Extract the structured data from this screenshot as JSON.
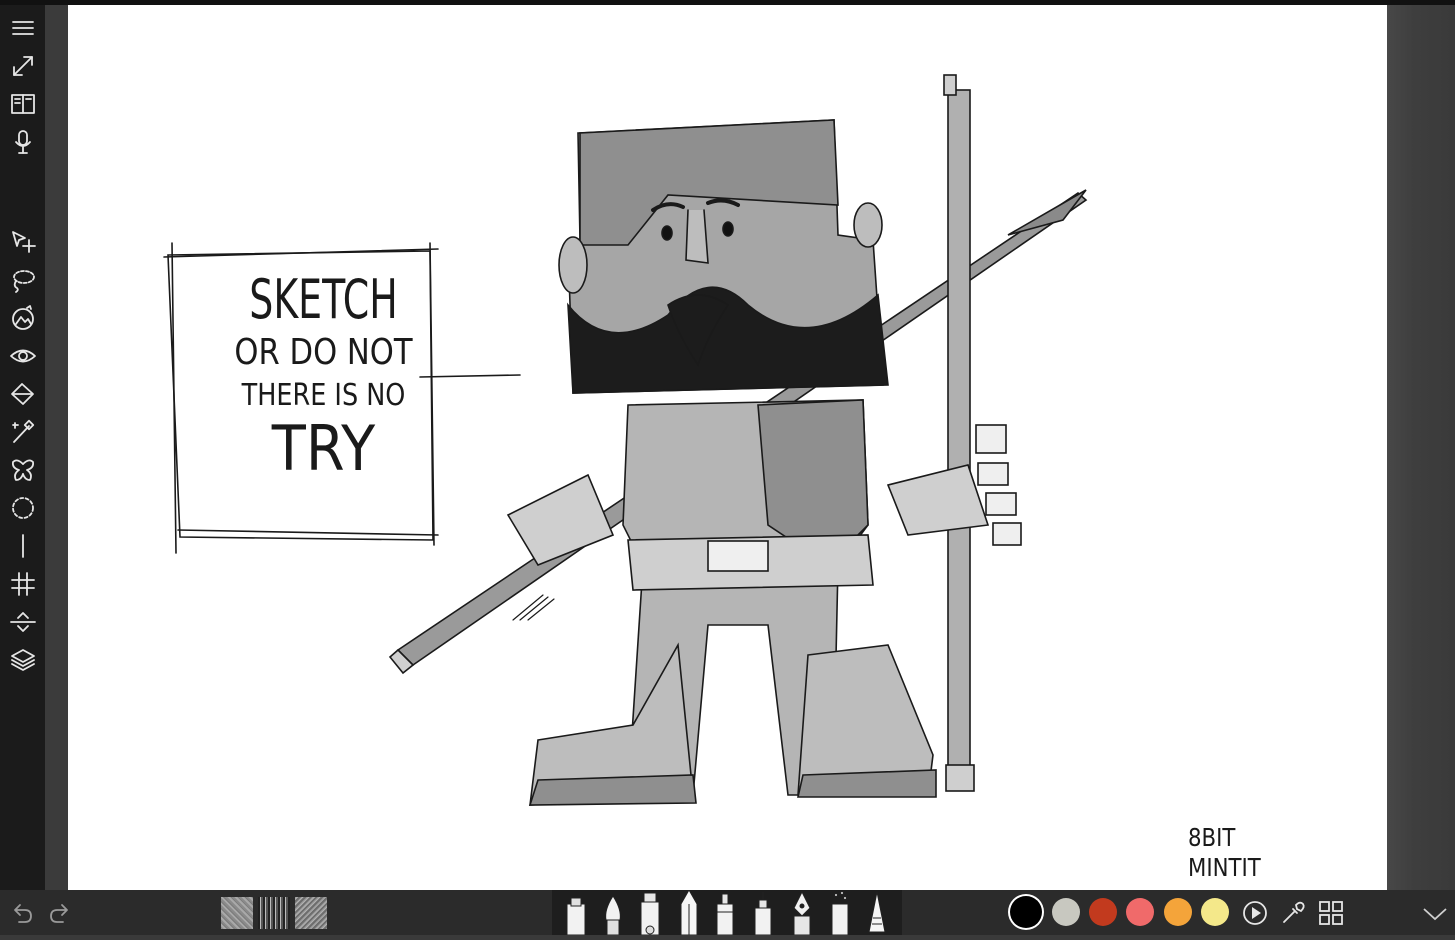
{
  "app": {
    "name": "sketch-app"
  },
  "canvas": {
    "sign_lines": [
      "SKETCH",
      "OR DO NOT",
      "THERE IS NO",
      "TRY"
    ],
    "signature_lines": [
      "8BIT",
      "MINTIT"
    ]
  },
  "left_toolbar": {
    "top_tools": [
      {
        "icon": "menu-icon"
      },
      {
        "icon": "fullscreen-icon"
      },
      {
        "icon": "book-icon"
      },
      {
        "icon": "microphone-icon"
      }
    ],
    "tools": [
      {
        "icon": "transform-icon"
      },
      {
        "icon": "lasso-select-icon"
      },
      {
        "icon": "image-adjust-icon"
      },
      {
        "icon": "eye-icon"
      },
      {
        "icon": "fill-bucket-icon"
      },
      {
        "icon": "magic-wand-icon"
      },
      {
        "icon": "symmetry-icon"
      },
      {
        "icon": "ellipse-guide-icon"
      },
      {
        "icon": "ruler-line-icon"
      },
      {
        "icon": "grid-icon"
      },
      {
        "icon": "perspective-icon"
      },
      {
        "icon": "layers-icon"
      }
    ]
  },
  "bottom_bar": {
    "history": [
      {
        "icon": "undo-icon"
      },
      {
        "icon": "redo-icon"
      }
    ],
    "textures": [
      "texture-1",
      "texture-2",
      "texture-3"
    ],
    "brushes": [
      "marker",
      "brush",
      "highlighter",
      "pencil",
      "felt-pen",
      "fineliner",
      "fountain-pen",
      "spray",
      "sharp-pencil"
    ],
    "colors": [
      "#000000",
      "#c8c8c0",
      "#c23a1e",
      "#f06a6a",
      "#f4a43a",
      "#f4e88a"
    ],
    "selected_color": "#000000",
    "actions": [
      {
        "icon": "play-icon"
      },
      {
        "icon": "eyedropper-icon"
      },
      {
        "icon": "grid-menu-icon"
      },
      {
        "icon": "chevron-down-icon"
      }
    ]
  }
}
